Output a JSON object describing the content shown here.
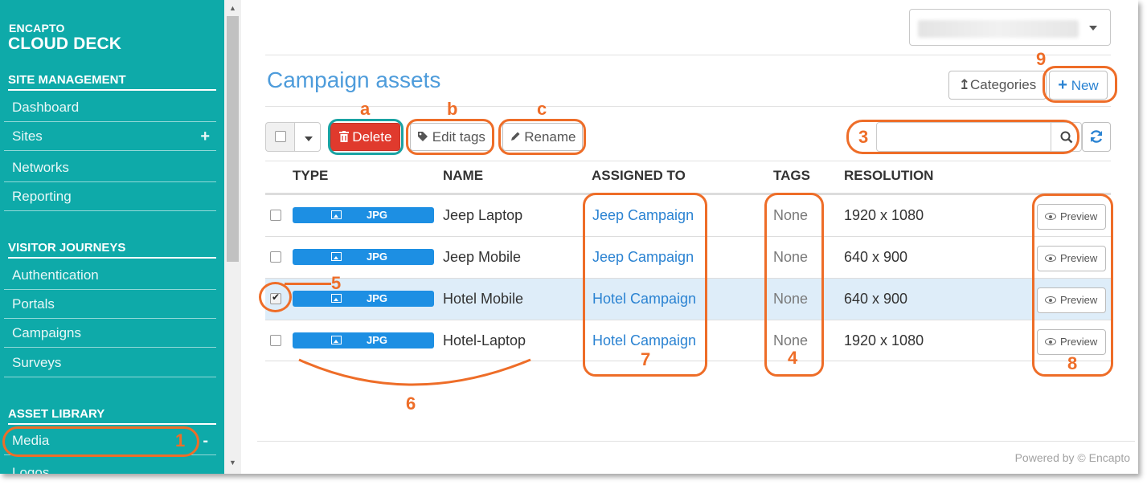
{
  "sidebar": {
    "brand_small": "ENCAPTO",
    "brand_big": "CLOUD DECK",
    "sections": [
      {
        "title": "SITE MANAGEMENT",
        "items": [
          "Dashboard",
          "Sites",
          "Networks",
          "Reporting"
        ]
      },
      {
        "title": "VISITOR JOURNEYS",
        "items": [
          "Authentication",
          "Portals",
          "Campaigns",
          "Surveys"
        ]
      },
      {
        "title": "ASSET LIBRARY",
        "items": [
          "Media",
          "Logos"
        ]
      }
    ],
    "plus_glyph": "+",
    "minus_glyph": "-"
  },
  "header": {
    "page_title": "Campaign assets",
    "categories_label": "Categories",
    "new_label": "New"
  },
  "toolbar": {
    "delete_label": "Delete",
    "edit_tags_label": "Edit tags",
    "rename_label": "Rename",
    "search_value": ""
  },
  "table": {
    "columns": [
      "TYPE",
      "NAME",
      "ASSIGNED TO",
      "TAGS",
      "RESOLUTION"
    ],
    "preview_label": "Preview",
    "rows": [
      {
        "type": "JPG",
        "name": "Jeep Laptop",
        "assigned": "Jeep Campaign",
        "tags": "None",
        "resolution": "1920 x 1080",
        "checked": false
      },
      {
        "type": "JPG",
        "name": "Jeep Mobile",
        "assigned": "Jeep Campaign",
        "tags": "None",
        "resolution": "640 x 900",
        "checked": false
      },
      {
        "type": "JPG",
        "name": "Hotel Mobile",
        "assigned": "Hotel Campaign",
        "tags": "None",
        "resolution": "640 x 900",
        "checked": true
      },
      {
        "type": "JPG",
        "name": "Hotel-Laptop",
        "assigned": "Hotel Campaign",
        "tags": "None",
        "resolution": "1920 x 1080",
        "checked": false
      }
    ]
  },
  "footer": {
    "text": "Powered by © Encapto"
  },
  "annotations": {
    "a": "a",
    "b": "b",
    "c": "c",
    "n1": "1",
    "n3": "3",
    "n4": "4",
    "n5": "5",
    "n6": "6",
    "n7": "7",
    "n8": "8",
    "n9": "9"
  },
  "colors": {
    "sidebar": "#0eaaa9",
    "accent_blue": "#2b83d2",
    "delete_red": "#e03a2d",
    "badge_blue": "#1d8fe3",
    "annotation_orange": "#ee6d28"
  }
}
